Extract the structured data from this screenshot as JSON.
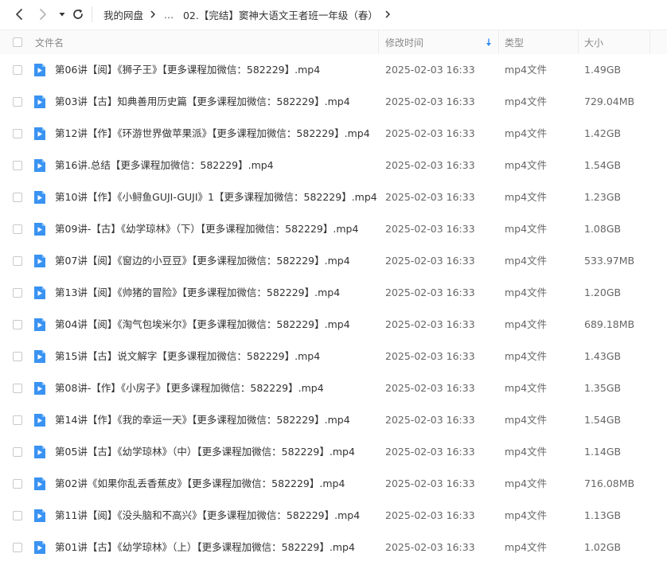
{
  "toolbar": {
    "back_icon": "chevron-left-icon",
    "forward_icon": "chevron-right-icon",
    "history_icon": "caret-down-icon",
    "refresh_icon": "refresh-icon"
  },
  "breadcrumb": {
    "root": "我的网盘",
    "ellipsis": "...",
    "current": "02.【完结】窦神大语文王者班一年级（春）"
  },
  "columns": {
    "name": "文件名",
    "modified": "修改时间",
    "type": "类型",
    "size": "大小",
    "sort_icon": "sort-down-arrow-icon"
  },
  "colors": {
    "accent": "#2e8df5",
    "file_icon": "#3a93f2"
  },
  "files": [
    {
      "name": "第06讲【阅】《狮子王》【更多课程加微信：582229】.mp4",
      "modified": "2025-02-03 16:33",
      "type": "mp4文件",
      "size": "1.49GB"
    },
    {
      "name": "第03讲【古】知典善用历史篇【更多课程加微信：582229】.mp4",
      "modified": "2025-02-03 16:33",
      "type": "mp4文件",
      "size": "729.04MB"
    },
    {
      "name": "第12讲【作】《环游世界做苹果派》【更多课程加微信：582229】.mp4",
      "modified": "2025-02-03 16:33",
      "type": "mp4文件",
      "size": "1.42GB"
    },
    {
      "name": "第16讲.总结【更多课程加微信：582229】.mp4",
      "modified": "2025-02-03 16:33",
      "type": "mp4文件",
      "size": "1.54GB"
    },
    {
      "name": "第10讲【作】《小鲟鱼GUJI-GUJI》1【更多课程加微信：582229】.mp4",
      "modified": "2025-02-03 16:33",
      "type": "mp4文件",
      "size": "1.23GB"
    },
    {
      "name": "第09讲-【古】《幼学琼林》（下）【更多课程加微信：582229】.mp4",
      "modified": "2025-02-03 16:33",
      "type": "mp4文件",
      "size": "1.08GB"
    },
    {
      "name": "第07讲【阅】《窗边的小豆豆》【更多课程加微信：582229】.mp4",
      "modified": "2025-02-03 16:33",
      "type": "mp4文件",
      "size": "533.97MB"
    },
    {
      "name": "第13讲【阅】《帅猪的冒险》【更多课程加微信：582229】.mp4",
      "modified": "2025-02-03 16:33",
      "type": "mp4文件",
      "size": "1.20GB"
    },
    {
      "name": "第04讲【阅】《淘气包埃米尔》【更多课程加微信：582229】.mp4",
      "modified": "2025-02-03 16:33",
      "type": "mp4文件",
      "size": "689.18MB"
    },
    {
      "name": "第15讲【古】说文解字【更多课程加微信：582229】.mp4",
      "modified": "2025-02-03 16:33",
      "type": "mp4文件",
      "size": "1.43GB"
    },
    {
      "name": "第08讲-【作】《小房子》【更多课程加微信：582229】.mp4",
      "modified": "2025-02-03 16:33",
      "type": "mp4文件",
      "size": "1.35GB"
    },
    {
      "name": "第14讲【作】《我的幸运一天》【更多课程加微信：582229】.mp4",
      "modified": "2025-02-03 16:33",
      "type": "mp4文件",
      "size": "1.54GB"
    },
    {
      "name": "第05讲【古】《幼学琼林》（中）【更多课程加微信：582229】.mp4",
      "modified": "2025-02-03 16:33",
      "type": "mp4文件",
      "size": "1.14GB"
    },
    {
      "name": "第02讲《如果你乱丢香蕉皮》【更多课程加微信：582229】.mp4",
      "modified": "2025-02-03 16:33",
      "type": "mp4文件",
      "size": "716.08MB"
    },
    {
      "name": "第11讲【阅】《没头脑和不高兴》【更多课程加微信：582229】.mp4",
      "modified": "2025-02-03 16:33",
      "type": "mp4文件",
      "size": "1.13GB"
    },
    {
      "name": "第01讲【古】《幼学琼林》（上）【更多课程加微信：582229】.mp4",
      "modified": "2025-02-03 16:33",
      "type": "mp4文件",
      "size": "1.02GB"
    }
  ]
}
